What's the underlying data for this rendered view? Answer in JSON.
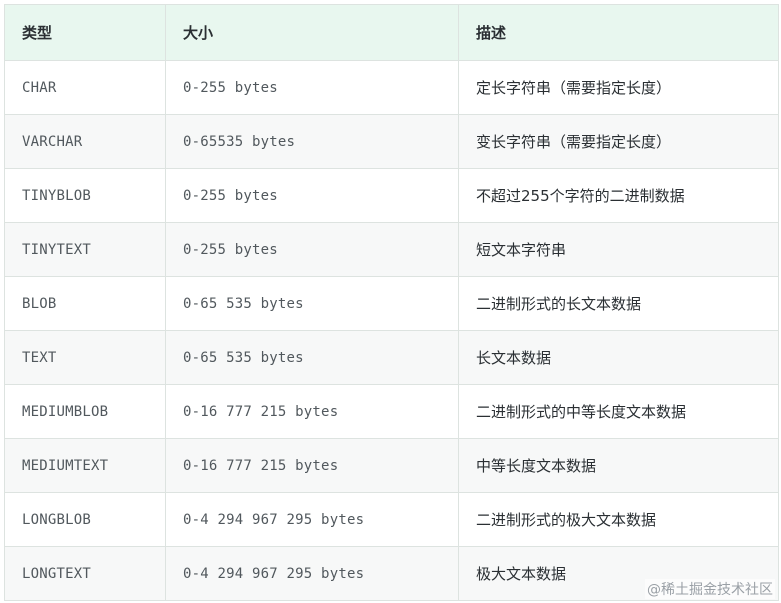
{
  "table": {
    "headers": [
      "类型",
      "大小",
      "描述"
    ],
    "rows": [
      {
        "type": "CHAR",
        "size": "0-255 bytes",
        "desc": "定长字符串（需要指定长度）"
      },
      {
        "type": "VARCHAR",
        "size": "0-65535 bytes",
        "desc": "变长字符串（需要指定长度）"
      },
      {
        "type": "TINYBLOB",
        "size": "0-255 bytes",
        "desc": "不超过255个字符的二进制数据"
      },
      {
        "type": "TINYTEXT",
        "size": "0-255 bytes",
        "desc": "短文本字符串"
      },
      {
        "type": "BLOB",
        "size": "0-65 535 bytes",
        "desc": "二进制形式的长文本数据"
      },
      {
        "type": "TEXT",
        "size": "0-65 535 bytes",
        "desc": "长文本数据"
      },
      {
        "type": "MEDIUMBLOB",
        "size": "0-16 777 215 bytes",
        "desc": "二进制形式的中等长度文本数据"
      },
      {
        "type": "MEDIUMTEXT",
        "size": "0-16 777 215 bytes",
        "desc": "中等长度文本数据"
      },
      {
        "type": "LONGBLOB",
        "size": "0-4 294 967 295 bytes",
        "desc": "二进制形式的极大文本数据"
      },
      {
        "type": "LONGTEXT",
        "size": "0-4 294 967 295 bytes",
        "desc": "极大文本数据"
      }
    ]
  },
  "watermark": "@稀土掘金技术社区"
}
